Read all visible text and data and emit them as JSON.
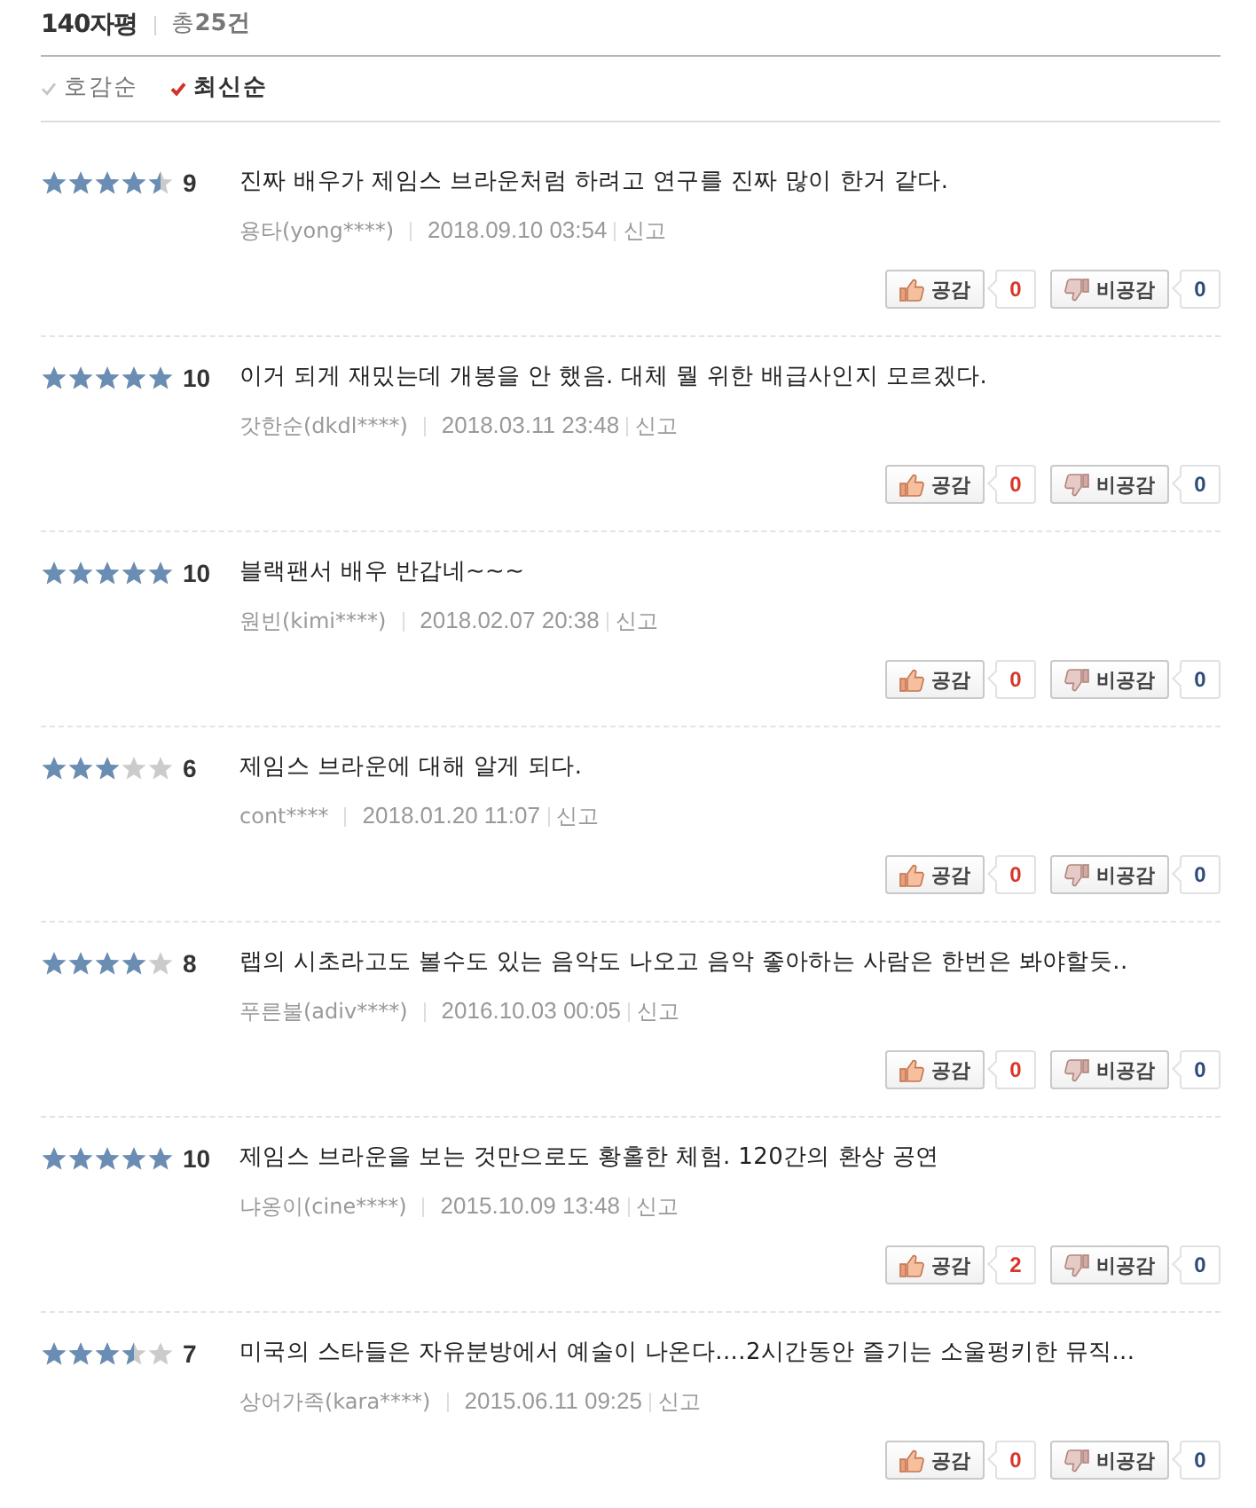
{
  "header": {
    "title": "140자평",
    "total": "총**25건**"
  },
  "sort_options": [
    {
      "label": "호감순",
      "selected": false
    },
    {
      "label": "최신순",
      "selected": true
    }
  ],
  "reviews": [
    {
      "stars": 4.5,
      "score": "9",
      "text": "진짜 배우가 제임스 브라운처럼 하려고 연구를 진짜 많이 한거 같다.",
      "author": "용타(yong****)",
      "date": "2018.09.10 03:54",
      "report": "신고",
      "like": {
        "label": "공감",
        "count": "0"
      },
      "dislike": {
        "label": "비공감",
        "count": "0"
      }
    },
    {
      "stars": 5,
      "score": "10",
      "text": "이거 되게 재밌는데 개봉을 안 했음. 대체 뭘 위한 배급사인지 모르겠다.",
      "author": "갓한순(dkdl****)",
      "date": "2018.03.11 23:48",
      "report": "신고",
      "like": {
        "label": "공감",
        "count": "0"
      },
      "dislike": {
        "label": "비공감",
        "count": "0"
      }
    },
    {
      "stars": 5,
      "score": "10",
      "text": "블랙팬서 배우 반갑네~~~",
      "author": "원빈(kimi****)",
      "date": "2018.02.07 20:38",
      "report": "신고",
      "like": {
        "label": "공감",
        "count": "0"
      },
      "dislike": {
        "label": "비공감",
        "count": "0"
      }
    },
    {
      "stars": 3,
      "score": "6",
      "text": "제임스 브라운에 대해 알게 되다.",
      "author": "cont****",
      "date": "2018.01.20 11:07",
      "report": "신고",
      "like": {
        "label": "공감",
        "count": "0"
      },
      "dislike": {
        "label": "비공감",
        "count": "0"
      }
    },
    {
      "stars": 4,
      "score": "8",
      "text": "랩의 시초라고도 볼수도 있는 음악도 나오고 음악 좋아하는 사람은 한번은 봐야할듯..",
      "author": "푸른불(adiv****)",
      "date": "2016.10.03 00:05",
      "report": "신고",
      "like": {
        "label": "공감",
        "count": "0"
      },
      "dislike": {
        "label": "비공감",
        "count": "0"
      }
    },
    {
      "stars": 5,
      "score": "10",
      "text": "제임스 브라운을 보는 것만으로도 황홀한 체험. 120간의 환상 공연",
      "author": "냐옹이(cine****)",
      "date": "2015.10.09 13:48",
      "report": "신고",
      "like": {
        "label": "공감",
        "count": "2"
      },
      "dislike": {
        "label": "비공감",
        "count": "0"
      }
    },
    {
      "stars": 3.5,
      "score": "7",
      "text": "미국의 스타들은 자유분방에서 예술이 나온다....2시간동안 즐기는 소울펑키한 뮤직...",
      "author": "상어가족(kara****)",
      "date": "2015.06.11 09:25",
      "report": "신고",
      "like": {
        "label": "공감",
        "count": "0"
      },
      "dislike": {
        "label": "비공감",
        "count": "0"
      }
    }
  ]
}
